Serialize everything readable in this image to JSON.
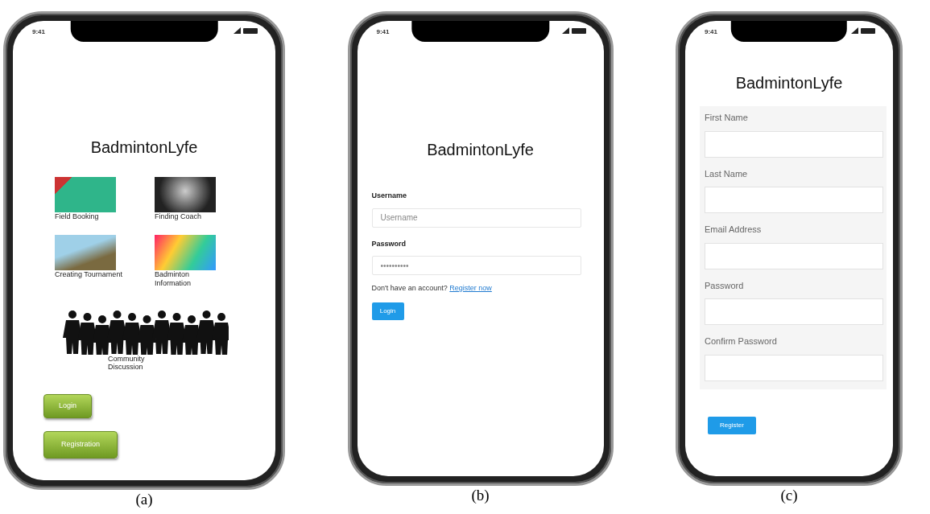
{
  "panels": [
    {
      "kind": "menu",
      "caption": "(a)",
      "status_time": "9:41",
      "title": "BadmintonLyfe",
      "tiles": [
        {
          "label": "Field Booking"
        },
        {
          "label": "Finding Coach"
        },
        {
          "label": "Creating Tournament"
        },
        {
          "label": "Badminton Information"
        }
      ],
      "community_label": "Community Discussion",
      "buttons": [
        "Login",
        "Registration"
      ]
    },
    {
      "kind": "login",
      "caption": "(b)",
      "status_time": "9:41",
      "title": "BadmintonLyfe",
      "fields": [
        {
          "label": "Username",
          "placeholder": "Username"
        },
        {
          "label": "Password",
          "placeholder": "••••••••••"
        }
      ],
      "prompt": "Don't have an account?",
      "link": "Register now",
      "button": "Login"
    },
    {
      "kind": "register",
      "caption": "(c)",
      "status_time": "9:41",
      "title": "BadmintonLyfe",
      "fields": [
        {
          "label": "First Name"
        },
        {
          "label": "Last Name"
        },
        {
          "label": "Email Address"
        },
        {
          "label": "Password"
        },
        {
          "label": "Confirm Password"
        }
      ],
      "button": "Register"
    }
  ]
}
